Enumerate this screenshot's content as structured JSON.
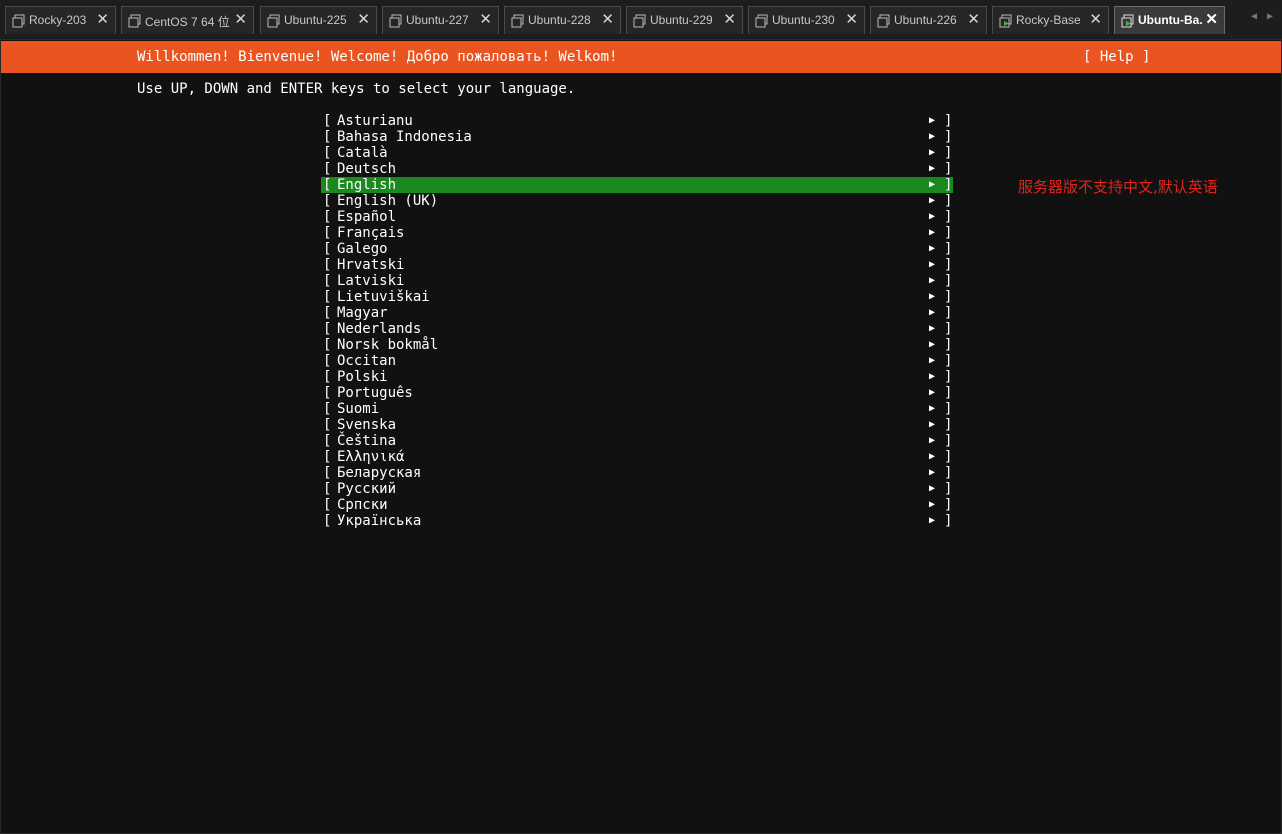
{
  "tabs": [
    {
      "label": "Rocky-203",
      "icon": "vm-icon",
      "active": false
    },
    {
      "label": "CentOS 7 64 位",
      "icon": "vm-icon",
      "active": false
    },
    {
      "label": "Ubuntu-225",
      "icon": "vm-icon",
      "active": false
    },
    {
      "label": "Ubuntu-227",
      "icon": "vm-icon",
      "active": false
    },
    {
      "label": "Ubuntu-228",
      "icon": "vm-icon",
      "active": false
    },
    {
      "label": "Ubuntu-229",
      "icon": "vm-icon",
      "active": false
    },
    {
      "label": "Ubuntu-230",
      "icon": "vm-icon",
      "active": false
    },
    {
      "label": "Ubuntu-226",
      "icon": "vm-icon",
      "active": false
    },
    {
      "label": "Rocky-Base",
      "icon": "vm-running-icon",
      "active": false
    },
    {
      "label": "Ubuntu-Ba...",
      "icon": "vm-running-icon",
      "active": true
    }
  ],
  "tab_close_glyph": "✕",
  "tab_nav": {
    "prev": "◀",
    "next": "▶"
  },
  "installer": {
    "welcome": "Willkommen! Bienvenue! Welcome! Добро пожаловать! Welkom!",
    "help": "[ Help ]",
    "instructions": "Use UP, DOWN and ENTER keys to select your language.",
    "languages": [
      "Asturianu",
      "Bahasa Indonesia",
      "Català",
      "Deutsch",
      "English",
      "English (UK)",
      "Español",
      "Français",
      "Galego",
      "Hrvatski",
      "Latviski",
      "Lietuviškai",
      "Magyar",
      "Nederlands",
      "Norsk bokmål",
      "Occitan",
      "Polski",
      "Português",
      "Suomi",
      "Svenska",
      "Čeština",
      "Ελληνικά",
      "Беларуская",
      "Русский",
      "Српски",
      "Українська"
    ],
    "selected_language": "English",
    "left_bracket": "[",
    "right_bracket": "]",
    "arrow": "▶"
  },
  "annotation": "服务器版不支持中文,默认英语",
  "colors": {
    "header": "#e95420",
    "selected_row": "#1b8a1e",
    "annotation": "#e0241b",
    "background": "#111111"
  }
}
